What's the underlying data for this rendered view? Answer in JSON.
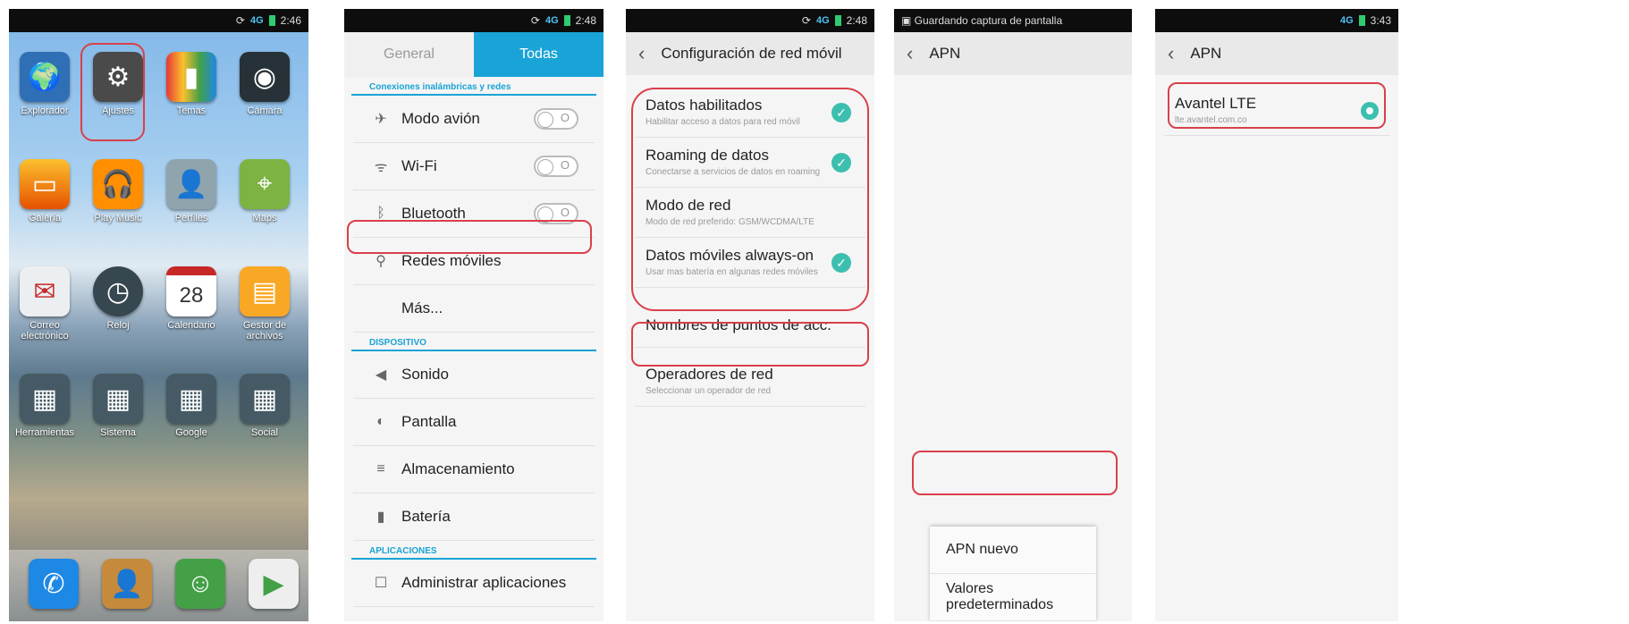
{
  "phone1": {
    "time": "2:46",
    "apps": [
      "Explorador",
      "Ajustes",
      "Temas",
      "Cámara",
      "Galería",
      "Play Music",
      "Perfiles",
      "Maps",
      "Correo electrónico",
      "Reloj",
      "Calendario",
      "Gestor de archivos",
      "Herramientas",
      "Sistema",
      "Google",
      "Social"
    ],
    "calendar_day": "28"
  },
  "phone2": {
    "time": "2:48",
    "tabs": [
      "General",
      "Todas"
    ],
    "section_wireless": "Conexiones inalámbricas y redes",
    "airplane": "Modo avión",
    "wifi": "Wi-Fi",
    "bluetooth": "Bluetooth",
    "mobile_networks": "Redes móviles",
    "more": "Más...",
    "section_device": "DISPOSITIVO",
    "sound": "Sonido",
    "display": "Pantalla",
    "storage": "Almacenamiento",
    "battery": "Batería",
    "section_apps": "APLICACIONES",
    "manage_apps": "Administrar aplicaciones"
  },
  "phone3": {
    "time": "2:48",
    "title": "Configuración de red móvil",
    "items": [
      {
        "title": "Datos habilitados",
        "subtitle": "Habilitar acceso a datos para red móvil"
      },
      {
        "title": "Roaming de datos",
        "subtitle": "Conectarse a servicios de datos en roaming"
      },
      {
        "title": "Modo de red",
        "subtitle": "Modo de red preferido: GSM/WCDMA/LTE"
      },
      {
        "title": "Datos móviles always-on",
        "subtitle": "Usar mas batería en algunas redes móviles"
      }
    ],
    "apn_names": "Nombres de puntos de acc.",
    "operators": "Operadores de red",
    "operators_sub": "Seleccionar un operador de red"
  },
  "phone4": {
    "notification": "Guardando captura de pantalla",
    "title": "APN",
    "menu": [
      "APN nuevo",
      "Valores predeterminados"
    ]
  },
  "phone5": {
    "time": "3:43",
    "title": "APN",
    "apn_name": "Avantel LTE",
    "apn_value": "lte.avantel.com.co"
  },
  "colors": {
    "accent": "#1aa3d6",
    "check": "#3cbfae",
    "highlight": "#d9404a"
  }
}
